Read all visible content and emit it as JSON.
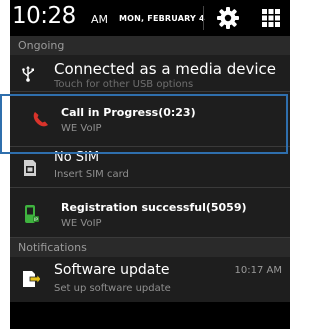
{
  "status_bar": {
    "time": "10:28",
    "ampm": "AM",
    "date": "MON, FEBRUARY 4"
  },
  "sections": {
    "ongoing": "Ongoing",
    "notifications": "Notifications"
  },
  "ongoing": {
    "usb": {
      "title": "Connected as a media device",
      "subtitle": "Touch for other USB options",
      "icon": "usb-icon"
    },
    "call": {
      "title": "Call in Progress(0:23)",
      "subtitle": "WE VoIP",
      "icon": "phone-handset-icon"
    },
    "sim": {
      "title": "No SIM",
      "subtitle": "Insert SIM card",
      "icon": "sim-card-icon"
    },
    "registration": {
      "title": "Registration successful(5059)",
      "subtitle": "WE VoIP",
      "icon": "voip-phone-icon"
    }
  },
  "notifications": {
    "update": {
      "title": "Software update",
      "subtitle": "Set up software update",
      "time": "10:17 AM",
      "icon": "software-update-icon"
    }
  },
  "colors": {
    "shade_bg": "#000000",
    "row_bg": "#1e1e1e",
    "header_bg": "#2a2a2a",
    "call_icon": "#d9332b",
    "voip_icon": "#3fb33f",
    "highlight_border": "#2f6fad"
  }
}
